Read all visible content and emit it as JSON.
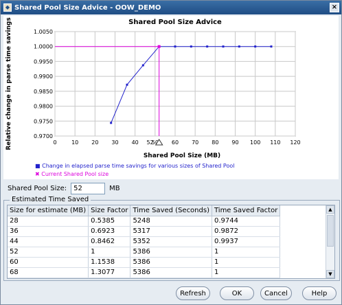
{
  "window": {
    "title": "Shared Pool Size Advice - OOW_DEMO"
  },
  "chart_data": {
    "type": "line",
    "title": "Shared Pool Size Advice",
    "xlabel": "Shared Pool Size (MB)",
    "ylabel": "Relative change in parse time savings",
    "xlim": [
      0,
      120
    ],
    "ylim": [
      0.97,
      1.005
    ],
    "x_ticks": [
      "0",
      "10",
      "20",
      "30",
      "40",
      "50",
      "60",
      "70",
      "80",
      "90",
      "100",
      "110",
      "120"
    ],
    "y_ticks": [
      "0.9700",
      "0.9750",
      "0.9800",
      "0.9850",
      "0.9900",
      "0.9950",
      "1.0000",
      "1.0050"
    ],
    "grid": true,
    "legend_position": "bottom",
    "series": [
      {
        "name": "Change in elapsed parse time savings for various sizes of Shared Pool",
        "color": "#2222cc",
        "x": [
          28,
          36,
          44,
          52,
          60,
          68,
          76,
          84,
          92,
          100,
          108
        ],
        "values": [
          0.9744,
          0.9872,
          0.9937,
          1.0,
          1.0,
          1.0,
          1.0,
          1.0,
          1.0,
          1.0,
          1.0
        ]
      },
      {
        "name": "Current Shared Pool size",
        "color": "#dd00dd",
        "x": [
          52
        ],
        "values": [
          1.0
        ]
      }
    ],
    "marker_label": "52"
  },
  "form": {
    "shared_pool_label": "Shared Pool Size:",
    "shared_pool_value": "52",
    "unit": "MB"
  },
  "estimated": {
    "group_title": "Estimated Time Saved",
    "columns": [
      "Size for estimate (MB)",
      "Size Factor",
      "Time Saved (Seconds)",
      "Time Saved Factor"
    ],
    "rows": [
      [
        "28",
        "0.5385",
        "5248",
        "0.9744"
      ],
      [
        "36",
        "0.6923",
        "5317",
        "0.9872"
      ],
      [
        "44",
        "0.8462",
        "5352",
        "0.9937"
      ],
      [
        "52",
        "1",
        "5386",
        "1"
      ],
      [
        "60",
        "1.1538",
        "5386",
        "1"
      ],
      [
        "68",
        "1.3077",
        "5386",
        "1"
      ]
    ]
  },
  "buttons": {
    "refresh": "Refresh",
    "ok": "OK",
    "cancel": "Cancel",
    "help": "Help"
  }
}
